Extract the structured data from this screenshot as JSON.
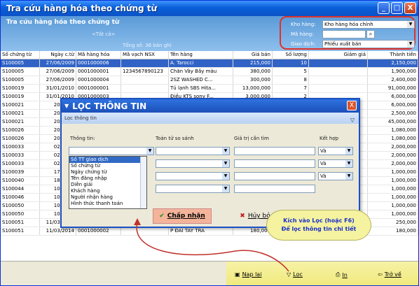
{
  "window": {
    "title": "Tra cứu hàng hóa theo chứng từ",
    "buttons": [
      "_",
      "□",
      "X"
    ]
  },
  "header": {
    "title": "Tra cứu hàng hóa theo chứng từ",
    "all": "<Tất cả>",
    "total": "Tổng số: 36 bản ghi"
  },
  "filters": {
    "warehouse_label": "Kho hàng:",
    "warehouse_value": "Kho hàng hóa chính",
    "code_label": "Mã hàng:",
    "code_value": "",
    "trans_label": "Giao dịch:",
    "trans_value": "Phiếu xuất bán"
  },
  "grid": {
    "columns": [
      "Số chứng từ",
      "Ngày c.từ",
      "Mã hàng hóa",
      "Mã vạch NSX",
      "Tên hàng",
      "Giá bán",
      "Số lượng",
      "Giảm giá",
      "Thành tiền"
    ],
    "rows": [
      [
        "S100005",
        "27/06/2009",
        "0001000006",
        "",
        "A. Tarocci",
        "215,000",
        "10",
        "",
        "2,150,000"
      ],
      [
        "S100005",
        "27/06/2009",
        "0001000001",
        "1234567890123",
        "Chăn Vây Bầy màu",
        "380,000",
        "5",
        "",
        "1,900,000"
      ],
      [
        "S100005",
        "27/06/2009",
        "0001000004",
        "",
        "2SZ WASHED C...",
        "300,000",
        "8",
        "",
        "2,400,000"
      ],
      [
        "S100019",
        "31/01/2010",
        "0001000001",
        "",
        "Tủ lạnh SBS Hita...",
        "13,000,000",
        "7",
        "",
        "91,000,000"
      ],
      [
        "S100019",
        "31/01/2010",
        "0001000003",
        "",
        "Điều KTS sony F...",
        "3,000,000",
        "2",
        "",
        "6,000,000"
      ],
      [
        "S100021",
        "20/03/...",
        "",
        "",
        "",
        "",
        "",
        "",
        "6,000,000"
      ],
      [
        "S100021",
        "20/03/...",
        "",
        "",
        "",
        "",
        "",
        "",
        "2,500,000"
      ],
      [
        "S100021",
        "20/03/...",
        "",
        "",
        "",
        "",
        "",
        "",
        "45,000,000"
      ],
      [
        "S100026",
        "20/04/...",
        "",
        "",
        "",
        "",
        "",
        "",
        "1,080,000"
      ],
      [
        "S100026",
        "20/04/...",
        "",
        "",
        "",
        "",
        "",
        "",
        "1,080,000"
      ],
      [
        "S100033",
        "02/04/...",
        "",
        "",
        "",
        "",
        "",
        "",
        "2,000,000"
      ],
      [
        "S100033",
        "02/04/...",
        "",
        "",
        "",
        "",
        "",
        "",
        "2,000,000"
      ],
      [
        "S100033",
        "02/04/...",
        "",
        "",
        "",
        "",
        "",
        "",
        "2,000,000"
      ],
      [
        "S100039",
        "17/11/...",
        "",
        "",
        "",
        "",
        "",
        "",
        "1,000,000"
      ],
      [
        "S100040",
        "18/11/...",
        "",
        "",
        "",
        "",
        "",
        "",
        "1,000,000"
      ],
      [
        "S100044",
        "10/03/...",
        "",
        "",
        "",
        "",
        "",
        "",
        "1,000,000"
      ],
      [
        "S100046",
        "10/03/...",
        "",
        "",
        "",
        "",
        "",
        "",
        "1,000,000"
      ],
      [
        "S100050",
        "10/03/...",
        "",
        "",
        "",
        "",
        "",
        "",
        "1,000,000"
      ],
      [
        "S100050",
        "10/03/...",
        "",
        "",
        "",
        "",
        "",
        "",
        "1,000,000"
      ],
      [
        "S100051",
        "11/03/2014",
        "0001000005",
        "",
        "Q. CQW 97594",
        "250,000",
        "",
        "",
        "250,000"
      ],
      [
        "S100051",
        "11/03/2014",
        "0001000002",
        "",
        "P ĐAI TAY TRA",
        "180,000",
        "",
        "",
        "180,000"
      ]
    ]
  },
  "toolbar": {
    "reload": "Nạp lại",
    "filter": "Lọc",
    "print": "In",
    "back": "Trở về"
  },
  "dialog": {
    "title": "LỌC THÔNG TIN",
    "subtitle": "Lọc thông tin",
    "col_info": "Thông tin:",
    "col_op": "Toán tử so sánh",
    "col_value": "Giá trị cần tìm",
    "col_join": "Kết hợp",
    "join_value": "Và",
    "options": [
      "Số TT giao dịch",
      "Số chứng từ",
      "Ngày chứng từ",
      "Tên đăng nhập",
      "Diễn giải",
      "Khách hàng",
      "Người nhận hàng",
      "Hình thức thanh toán"
    ],
    "ok": "Chấp nhận",
    "cancel": "Hủy bỏ"
  },
  "tip": {
    "line1": "Kích vào Lọc (hoặc F6)",
    "line2": "Để lọc thông tin chi tiết"
  }
}
